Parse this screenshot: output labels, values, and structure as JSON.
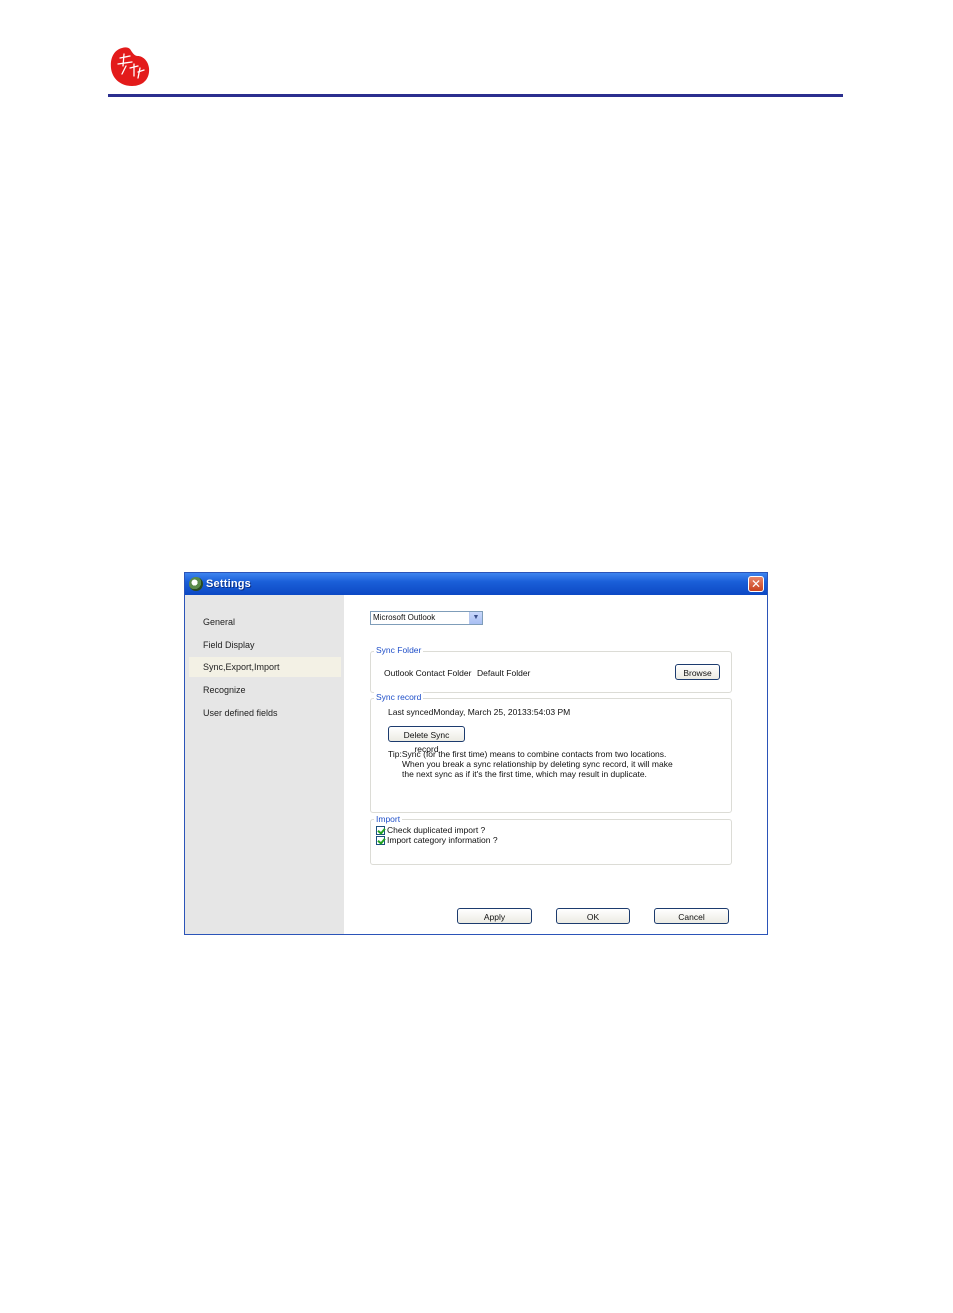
{
  "window": {
    "title": "Settings",
    "close_glyph": "✕"
  },
  "sidebar": {
    "items": [
      {
        "label": "General"
      },
      {
        "label": "Field Display"
      },
      {
        "label": "Sync,Export,Import",
        "selected": true
      },
      {
        "label": "Recognize"
      },
      {
        "label": "User defined fields"
      }
    ]
  },
  "source_select": {
    "value": "Microsoft Outlook"
  },
  "sync_folder": {
    "legend": "Sync Folder",
    "label": "Outlook Contact Folder",
    "value": "Default Folder",
    "browse_label": "Browse"
  },
  "sync_record": {
    "legend": "Sync record",
    "last_synced": "Last syncedMonday, March 25, 20133:54:03 PM",
    "delete_label": "Delete Sync record",
    "tip_line1": "Tip:Sync (for the first time) means to combine contacts from two locations.",
    "tip_line2": "When you break a sync relationship by deleting sync record, it will make",
    "tip_line3": "the next sync as if it's the first time, which may result in duplicate."
  },
  "import": {
    "legend": "Import",
    "options": [
      {
        "label": "Check duplicated import ?",
        "checked": true
      },
      {
        "label": "Import category information ?",
        "checked": true
      }
    ]
  },
  "footer": {
    "apply_label": "Apply",
    "ok_label": "OK",
    "cancel_label": "Cancel"
  },
  "colors": {
    "header_rule": "#2b2f8f",
    "logo": "#e31b1b",
    "titlebar": "#0c48c4",
    "legend_text": "#1f4fc9",
    "sidebar_bg": "#e6e6e6"
  },
  "icons": {
    "logo": "red-seal-logo-icon",
    "title": "app-icon",
    "dropdown": "chevron-down-icon",
    "close": "close-icon"
  }
}
